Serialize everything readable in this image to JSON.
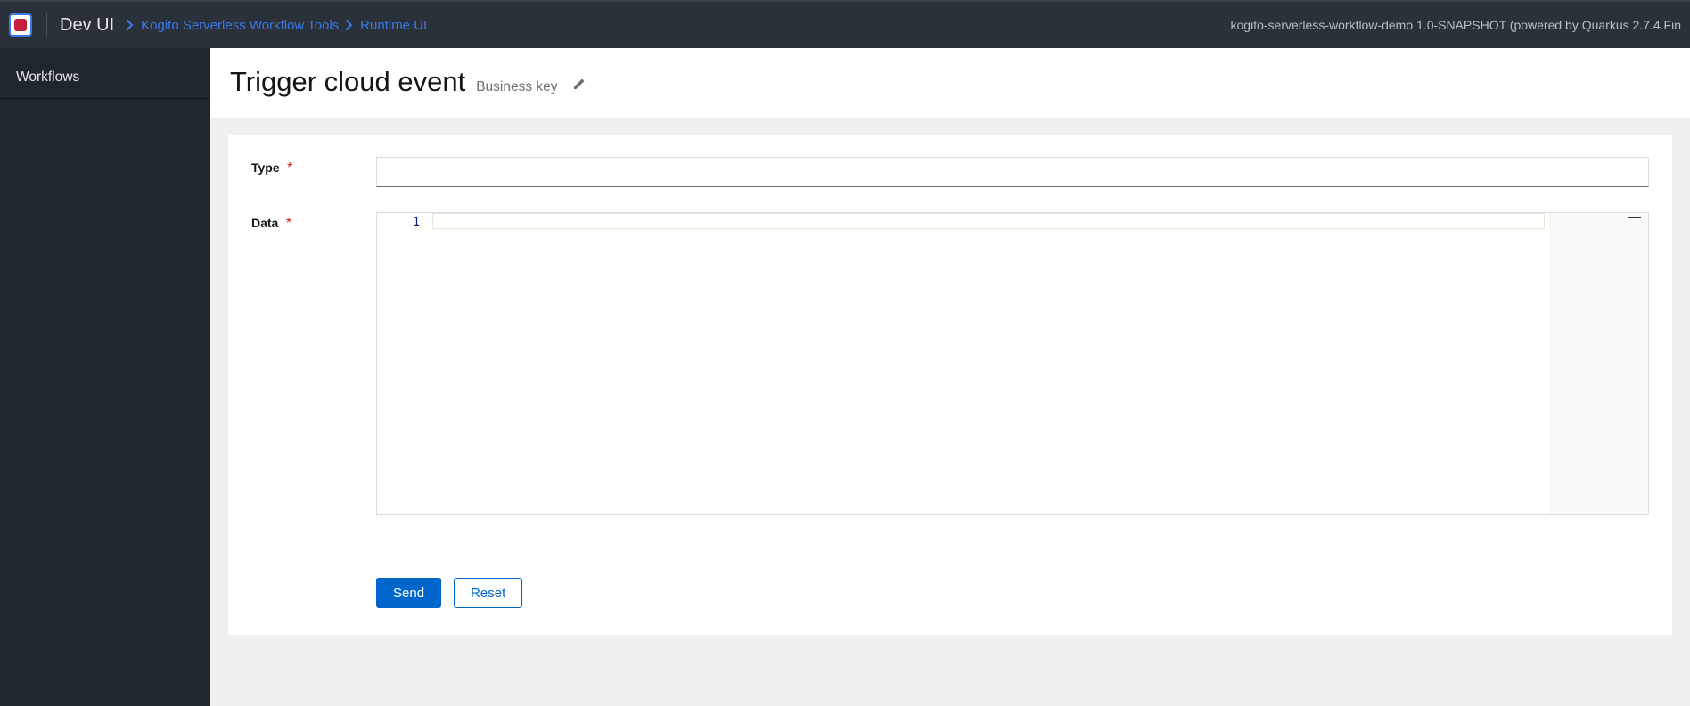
{
  "header": {
    "brand": "Dev UI",
    "breadcrumb": [
      {
        "label": "Kogito Serverless Workflow Tools"
      },
      {
        "label": "Runtime UI"
      }
    ],
    "app_info": "kogito-serverless-workflow-demo 1.0-SNAPSHOT (powered by Quarkus 2.7.4.Fin"
  },
  "sidebar": {
    "items": [
      {
        "label": "Workflows"
      }
    ]
  },
  "page": {
    "title": "Trigger cloud event",
    "business_key_label": "Business key"
  },
  "form": {
    "type": {
      "label": "Type",
      "required_mark": "*",
      "value": ""
    },
    "data": {
      "label": "Data",
      "required_mark": "*",
      "gutter_start": "1",
      "value": ""
    }
  },
  "actions": {
    "send": "Send",
    "reset": "Reset"
  }
}
